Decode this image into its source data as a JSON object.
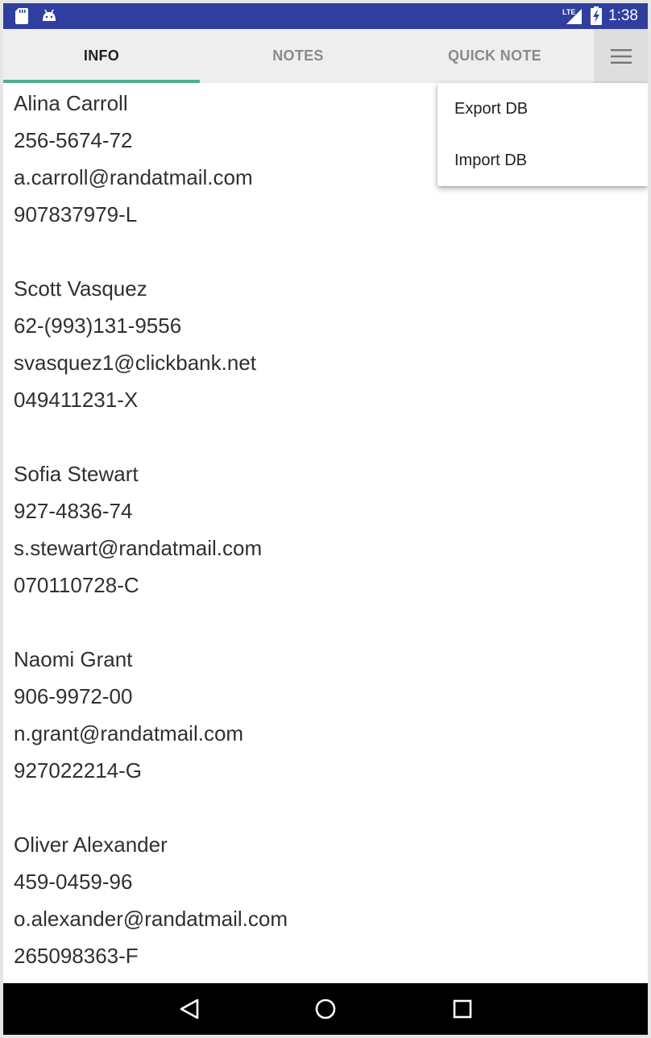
{
  "status_bar": {
    "time": "1:38",
    "network": "LTE",
    "left_icons": [
      "sd-card-icon",
      "android-icon"
    ],
    "right_icons": [
      "lte-signal-icon",
      "battery-charging-icon"
    ]
  },
  "tabs": [
    {
      "label": "INFO",
      "active": true
    },
    {
      "label": "NOTES",
      "active": false
    },
    {
      "label": "QUICK NOTE",
      "active": false
    }
  ],
  "menu_icon": "hamburger-menu-icon",
  "popup_menu": {
    "items": [
      {
        "label": "Export DB"
      },
      {
        "label": "Import DB"
      }
    ]
  },
  "contacts": [
    {
      "name": "Alina Carroll",
      "phone": "256-5674-72",
      "email": "a.carroll@randatmail.com",
      "id": "907837979-L"
    },
    {
      "name": "Scott Vasquez",
      "phone": "62-(993)131-9556",
      "email": "svasquez1@clickbank.net",
      "id": "049411231-X"
    },
    {
      "name": "Sofia Stewart",
      "phone": "927-4836-74",
      "email": "s.stewart@randatmail.com",
      "id": "070110728-C"
    },
    {
      "name": "Naomi Grant",
      "phone": "906-9972-00",
      "email": "n.grant@randatmail.com",
      "id": "927022214-G"
    },
    {
      "name": "Oliver Alexander",
      "phone": "459-0459-96",
      "email": "o.alexander@randatmail.com",
      "id": "265098363-F"
    }
  ],
  "nav_bar": {
    "buttons": [
      "back-icon",
      "home-icon",
      "recents-icon"
    ]
  },
  "colors": {
    "status_bar": "#303f9f",
    "tab_bar": "#eeeeee",
    "tab_indicator": "#4caf8e",
    "active_tab_text": "#212121",
    "inactive_tab_text": "#8a8a8a"
  }
}
